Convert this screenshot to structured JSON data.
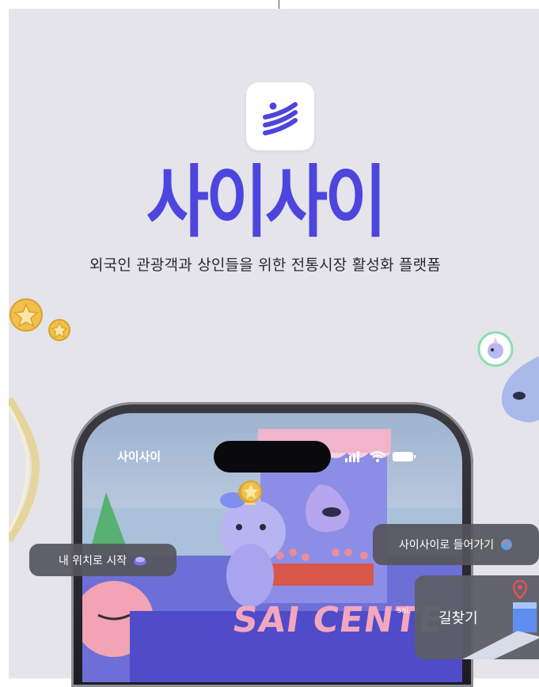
{
  "app": {
    "name": "사이사이",
    "tagline": "외국인 관광객과 상인들을 위한 전통시장 활성화 플랫폼"
  },
  "phone": {
    "screen_title": "사이사이",
    "scene_sign": "SAI CENTE",
    "scene_small_sign": "sai."
  },
  "buttons": {
    "start_from_location": "내 위치로 시작",
    "enter_saisai": "사이사이로 들어가기",
    "wayfinding": "길찾기"
  },
  "colors": {
    "brand": "#4d45de",
    "background": "#e4e4ea",
    "pill": "#55555c"
  },
  "icons": [
    "app-logo-icon",
    "star-coin-icon",
    "ring-icon",
    "unicorn-badge-icon",
    "signal-icon",
    "wifi-icon",
    "battery-icon",
    "globe-icon",
    "location-pin-icon",
    "button-icon"
  ]
}
